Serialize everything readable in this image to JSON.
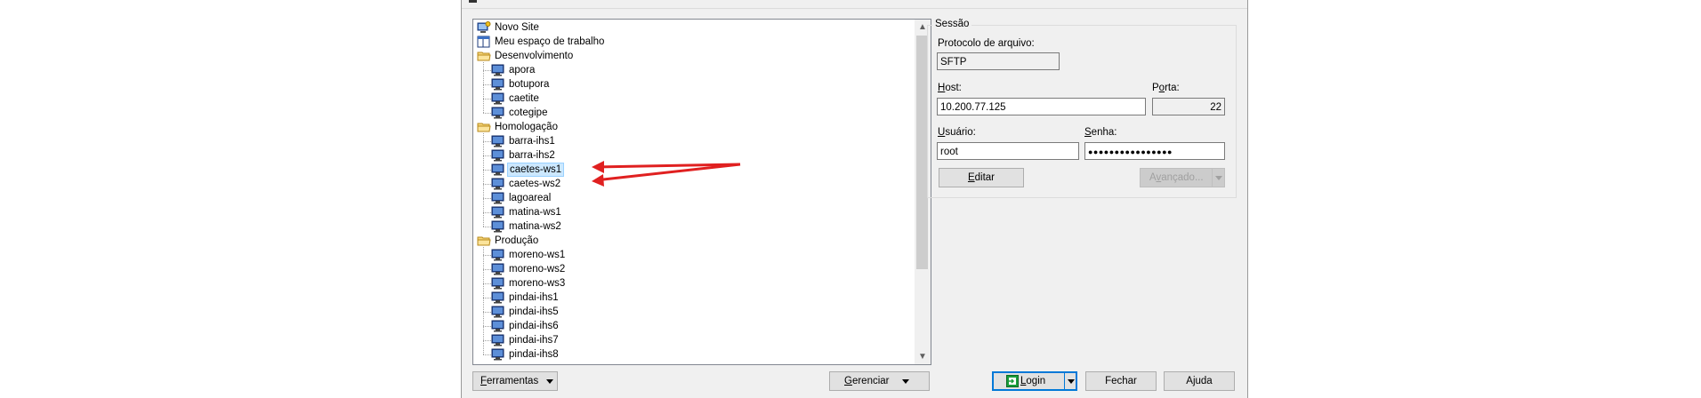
{
  "tree": {
    "items": [
      {
        "label": "Novo Site",
        "type": "new-site",
        "level": 0
      },
      {
        "label": "Meu espaço de trabalho",
        "type": "workspace",
        "level": 0
      },
      {
        "label": "Desenvolvimento",
        "type": "folder",
        "level": 0
      },
      {
        "label": "apora",
        "type": "site",
        "level": 1
      },
      {
        "label": "botupora",
        "type": "site",
        "level": 1
      },
      {
        "label": "caetite",
        "type": "site",
        "level": 1
      },
      {
        "label": "cotegipe",
        "type": "site",
        "level": 1
      },
      {
        "label": "Homologação",
        "type": "folder",
        "level": 0
      },
      {
        "label": "barra-ihs1",
        "type": "site",
        "level": 1
      },
      {
        "label": "barra-ihs2",
        "type": "site",
        "level": 1
      },
      {
        "label": "caetes-ws1",
        "type": "site",
        "level": 1,
        "selected": true
      },
      {
        "label": "caetes-ws2",
        "type": "site",
        "level": 1
      },
      {
        "label": "lagoareal",
        "type": "site",
        "level": 1
      },
      {
        "label": "matina-ws1",
        "type": "site",
        "level": 1
      },
      {
        "label": "matina-ws2",
        "type": "site",
        "level": 1
      },
      {
        "label": "Produção",
        "type": "folder",
        "level": 0
      },
      {
        "label": "moreno-ws1",
        "type": "site",
        "level": 1
      },
      {
        "label": "moreno-ws2",
        "type": "site",
        "level": 1
      },
      {
        "label": "moreno-ws3",
        "type": "site",
        "level": 1
      },
      {
        "label": "pindai-ihs1",
        "type": "site",
        "level": 1
      },
      {
        "label": "pindai-ihs5",
        "type": "site",
        "level": 1
      },
      {
        "label": "pindai-ihs6",
        "type": "site",
        "level": 1
      },
      {
        "label": "pindai-ihs7",
        "type": "site",
        "level": 1
      },
      {
        "label": "pindai-ihs8",
        "type": "site",
        "level": 1
      }
    ]
  },
  "session": {
    "legend": "Sessão",
    "protocol_label": "Protocolo de arquivo:",
    "protocol_value": "SFTP",
    "host_label_u": "H",
    "host_label_rest": "ost:",
    "host_value": "10.200.77.125",
    "port_label_pre": "P",
    "port_label_u": "o",
    "port_label_rest": "rta:",
    "port_value": "22",
    "user_label_u": "U",
    "user_label_rest": "suário:",
    "user_value": "root",
    "pass_label_u": "S",
    "pass_label_rest": "enha:",
    "pass_value": "●●●●●●●●●●●●●●●●",
    "edit_u": "E",
    "edit_rest": "ditar",
    "advanced_pre": "A",
    "advanced_u": "v",
    "advanced_rest": "ançado..."
  },
  "footer": {
    "tools_u": "F",
    "tools_rest": "erramentas",
    "manage_u": "G",
    "manage_rest": "erenciar",
    "login_u": "L",
    "login_rest": "ogin",
    "close": "Fechar",
    "help": "Ajuda"
  },
  "colors": {
    "annotation_arrow": "#e02020",
    "selection_bg": "#cce8ff",
    "default_button_border": "#0078d7",
    "dialog_bg": "#f0f0f0"
  }
}
